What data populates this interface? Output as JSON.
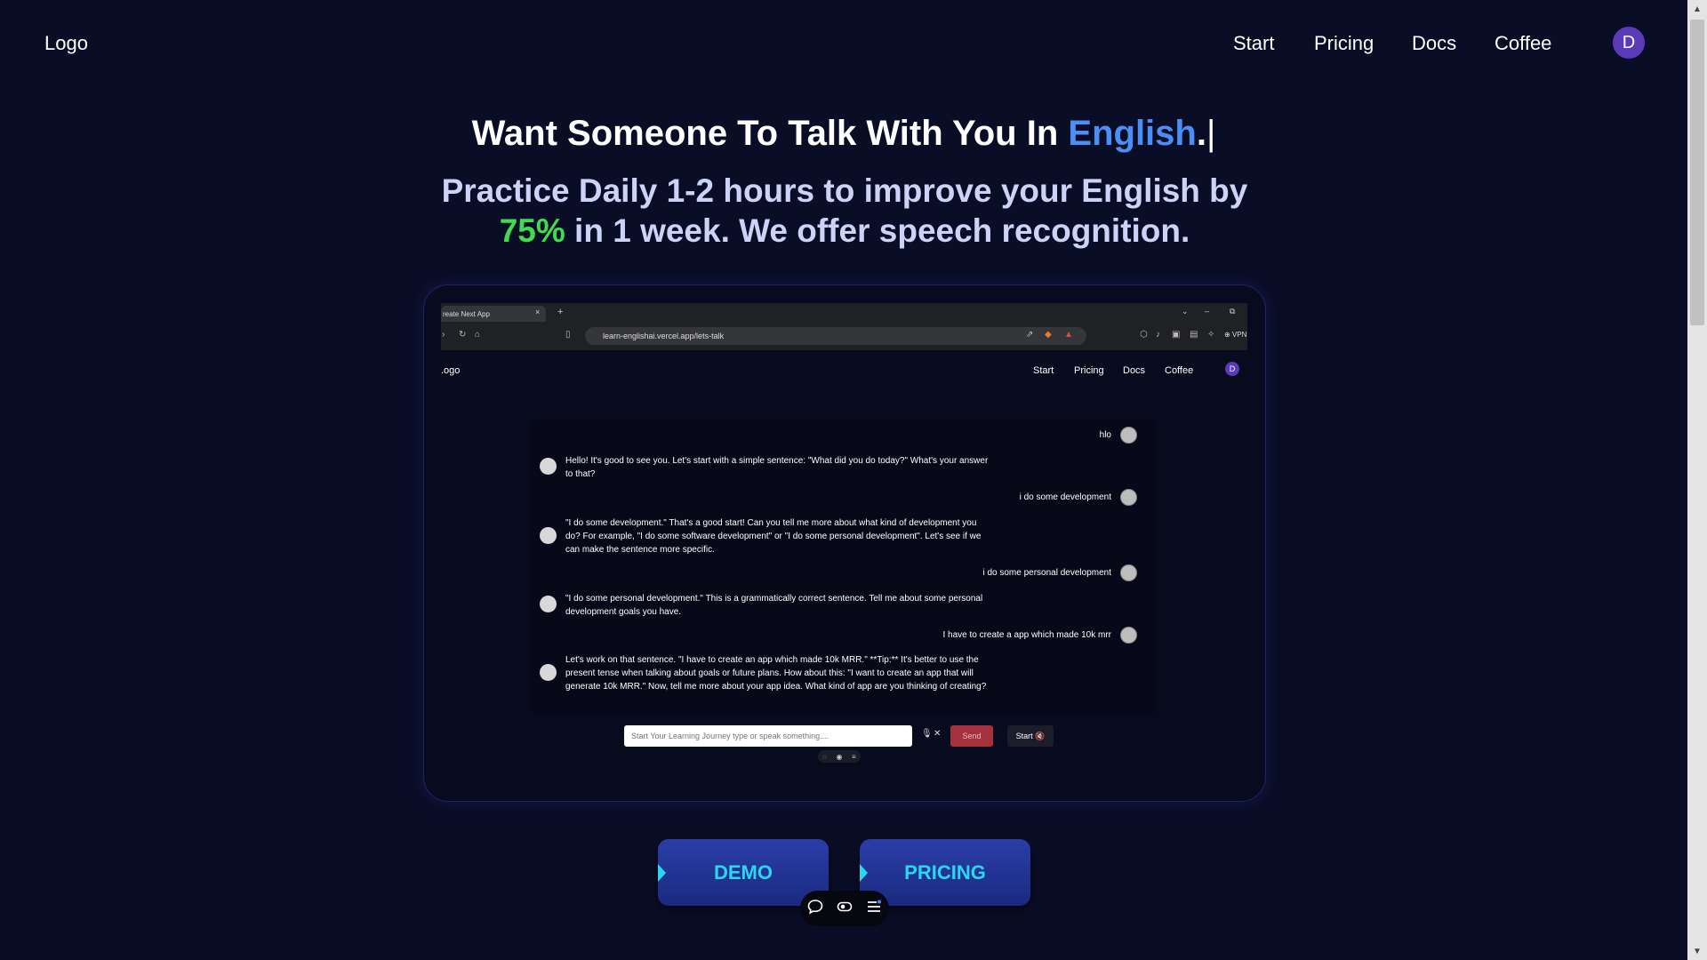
{
  "header": {
    "logo": "Logo",
    "nav": [
      "Start",
      "Pricing",
      "Docs",
      "Coffee"
    ],
    "avatar_initial": "D"
  },
  "hero": {
    "headline_prefix": "Want Someone To Talk With You In ",
    "headline_highlight": "English",
    "headline_suffix": ".",
    "typing_cursor": "|",
    "subhead_line1": "Practice Daily 1-2 hours to improve your English by",
    "subhead_pct": "75%",
    "subhead_line2": " in 1 week. We offer speech recognition."
  },
  "preview": {
    "browser": {
      "tab_title": "reate Next App",
      "tab_close": "×",
      "new_tab": "+",
      "url": "learn-englishai.vercel.app/lets-talk",
      "vpn": "⊕ VPN"
    },
    "inner_logo": ".ogo",
    "inner_nav": [
      "Start",
      "Pricing",
      "Docs",
      "Coffee"
    ],
    "inner_avatar": "D",
    "messages": [
      {
        "role": "user",
        "text": "hlo"
      },
      {
        "role": "bot",
        "text": "Hello! It's good to see you. Let's start with a simple sentence: \"What did you do today?\" What's your answer to that?"
      },
      {
        "role": "user",
        "text": "i do some development"
      },
      {
        "role": "bot",
        "text": "\"I do some development.\" That's a good start! Can you tell me more about what kind of development you do? For example, \"I do some software development\" or \"I do some personal development\". Let's see if we can make the sentence more specific."
      },
      {
        "role": "user",
        "text": "i do some personal development"
      },
      {
        "role": "bot",
        "text": "\"I do some personal development.\" This is a grammatically correct sentence. Tell me about some personal development goals you have."
      },
      {
        "role": "user",
        "text": "I have to create a app which made 10k mrr"
      },
      {
        "role": "bot",
        "text": "Let's work on that sentence. \"I have to create an app which made 10k MRR.\" **Tip:** It's better to use the present tense when talking about goals or future plans. How about this: \"I want to create an app that will generate 10k MRR.\" Now, tell me more about your app idea. What kind of app are you thinking of creating?"
      }
    ],
    "input_placeholder": "Start Your Learning Journey type or speak something....",
    "send_label": "Send",
    "start_label": "Start 🔇"
  },
  "cta": {
    "demo": "DEMO",
    "pricing": "PRICING"
  },
  "icons": {
    "chat": "chat-icon",
    "toggle": "toggle-icon",
    "menu": "menu-icon"
  },
  "colors": {
    "background": "#0a0d26",
    "highlight": "#4b8ef5",
    "percent": "#3fdb50",
    "cta_text": "#2ad7f0",
    "avatar": "#5b3ab8"
  }
}
